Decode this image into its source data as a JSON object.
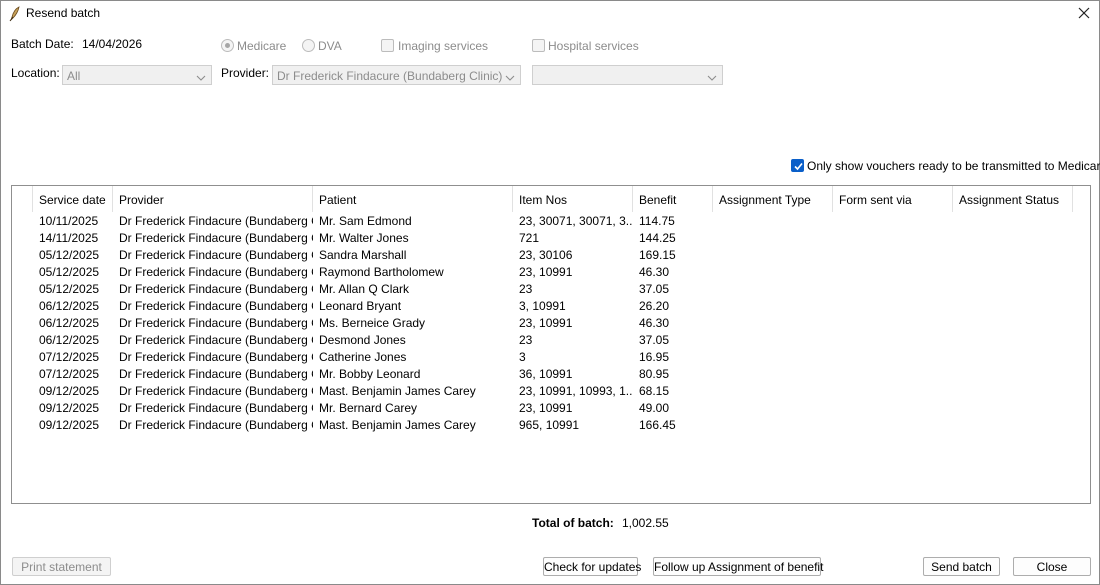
{
  "window": {
    "title": "Resend batch",
    "icon": "feather-pen-icon",
    "close_icon": "close-icon"
  },
  "filters": {
    "batch_date_label": "Batch Date:",
    "batch_date_value": "14/04/2026",
    "medicare_label": "Medicare",
    "medicare_selected": true,
    "dva_label": "DVA",
    "dva_selected": false,
    "imaging_label": "Imaging services",
    "imaging_checked": false,
    "hospital_label": "Hospital services",
    "hospital_checked": false,
    "location_label": "Location:",
    "location_value": "All",
    "provider_label": "Provider:",
    "provider_value": "Dr Frederick Findacure (Bundaberg Clinic)",
    "extra_value": "",
    "only_ready_label": "Only show vouchers ready to be transmitted to Medicare",
    "only_ready_checked": true
  },
  "table": {
    "columns": [
      "Service date",
      "Provider",
      "Patient",
      "Item Nos",
      "Benefit",
      "Assignment Type",
      "Form sent via",
      "Assignment Status"
    ],
    "rows": [
      {
        "date": "10/11/2025",
        "provider": "Dr Frederick Findacure (Bundaberg Cl...",
        "patient": "Mr. Sam Edmond",
        "items": "23, 30071, 30071, 3...",
        "benefit": "114.75"
      },
      {
        "date": "14/11/2025",
        "provider": "Dr Frederick Findacure (Bundaberg Cl...",
        "patient": "Mr. Walter Jones",
        "items": "721",
        "benefit": "144.25"
      },
      {
        "date": "05/12/2025",
        "provider": "Dr Frederick Findacure (Bundaberg Cl...",
        "patient": "Sandra Marshall",
        "items": "23, 30106",
        "benefit": "169.15"
      },
      {
        "date": "05/12/2025",
        "provider": "Dr Frederick Findacure (Bundaberg Cl...",
        "patient": "Raymond Bartholomew",
        "items": "23, 10991",
        "benefit": "46.30"
      },
      {
        "date": "05/12/2025",
        "provider": "Dr Frederick Findacure (Bundaberg Cl...",
        "patient": "Mr. Allan Q Clark",
        "items": "23",
        "benefit": "37.05"
      },
      {
        "date": "06/12/2025",
        "provider": "Dr Frederick Findacure (Bundaberg Cl...",
        "patient": "Leonard Bryant",
        "items": "3, 10991",
        "benefit": "26.20"
      },
      {
        "date": "06/12/2025",
        "provider": "Dr Frederick Findacure (Bundaberg Cl...",
        "patient": "Ms. Berneice Grady",
        "items": "23, 10991",
        "benefit": "46.30"
      },
      {
        "date": "06/12/2025",
        "provider": "Dr Frederick Findacure (Bundaberg Cl...",
        "patient": "Desmond Jones",
        "items": "23",
        "benefit": "37.05"
      },
      {
        "date": "07/12/2025",
        "provider": "Dr Frederick Findacure (Bundaberg Cl...",
        "patient": "Catherine Jones",
        "items": "3",
        "benefit": "16.95"
      },
      {
        "date": "07/12/2025",
        "provider": "Dr Frederick Findacure (Bundaberg Cl...",
        "patient": "Mr. Bobby Leonard",
        "items": "36, 10991",
        "benefit": "80.95"
      },
      {
        "date": "09/12/2025",
        "provider": "Dr Frederick Findacure (Bundaberg Cl...",
        "patient": "Mast. Benjamin James Carey",
        "items": "23, 10991, 10993, 1...",
        "benefit": "68.15"
      },
      {
        "date": "09/12/2025",
        "provider": "Dr Frederick Findacure (Bundaberg Cl...",
        "patient": "Mr. Bernard Carey",
        "items": "23, 10991",
        "benefit": "49.00"
      },
      {
        "date": "09/12/2025",
        "provider": "Dr Frederick Findacure (Bundaberg Cl...",
        "patient": "Mast. Benjamin James Carey",
        "items": "965, 10991",
        "benefit": "166.45"
      }
    ]
  },
  "total": {
    "label": "Total of batch:",
    "value": "1,002.55"
  },
  "buttons": {
    "print_statement": "Print statement",
    "check_updates": "Check for updates",
    "follow_up": "Follow up Assignment of benefit",
    "send_batch": "Send batch",
    "close": "Close"
  },
  "colors": {
    "accent": "#0a5fc9",
    "disabled_text": "#8c8c8c"
  }
}
